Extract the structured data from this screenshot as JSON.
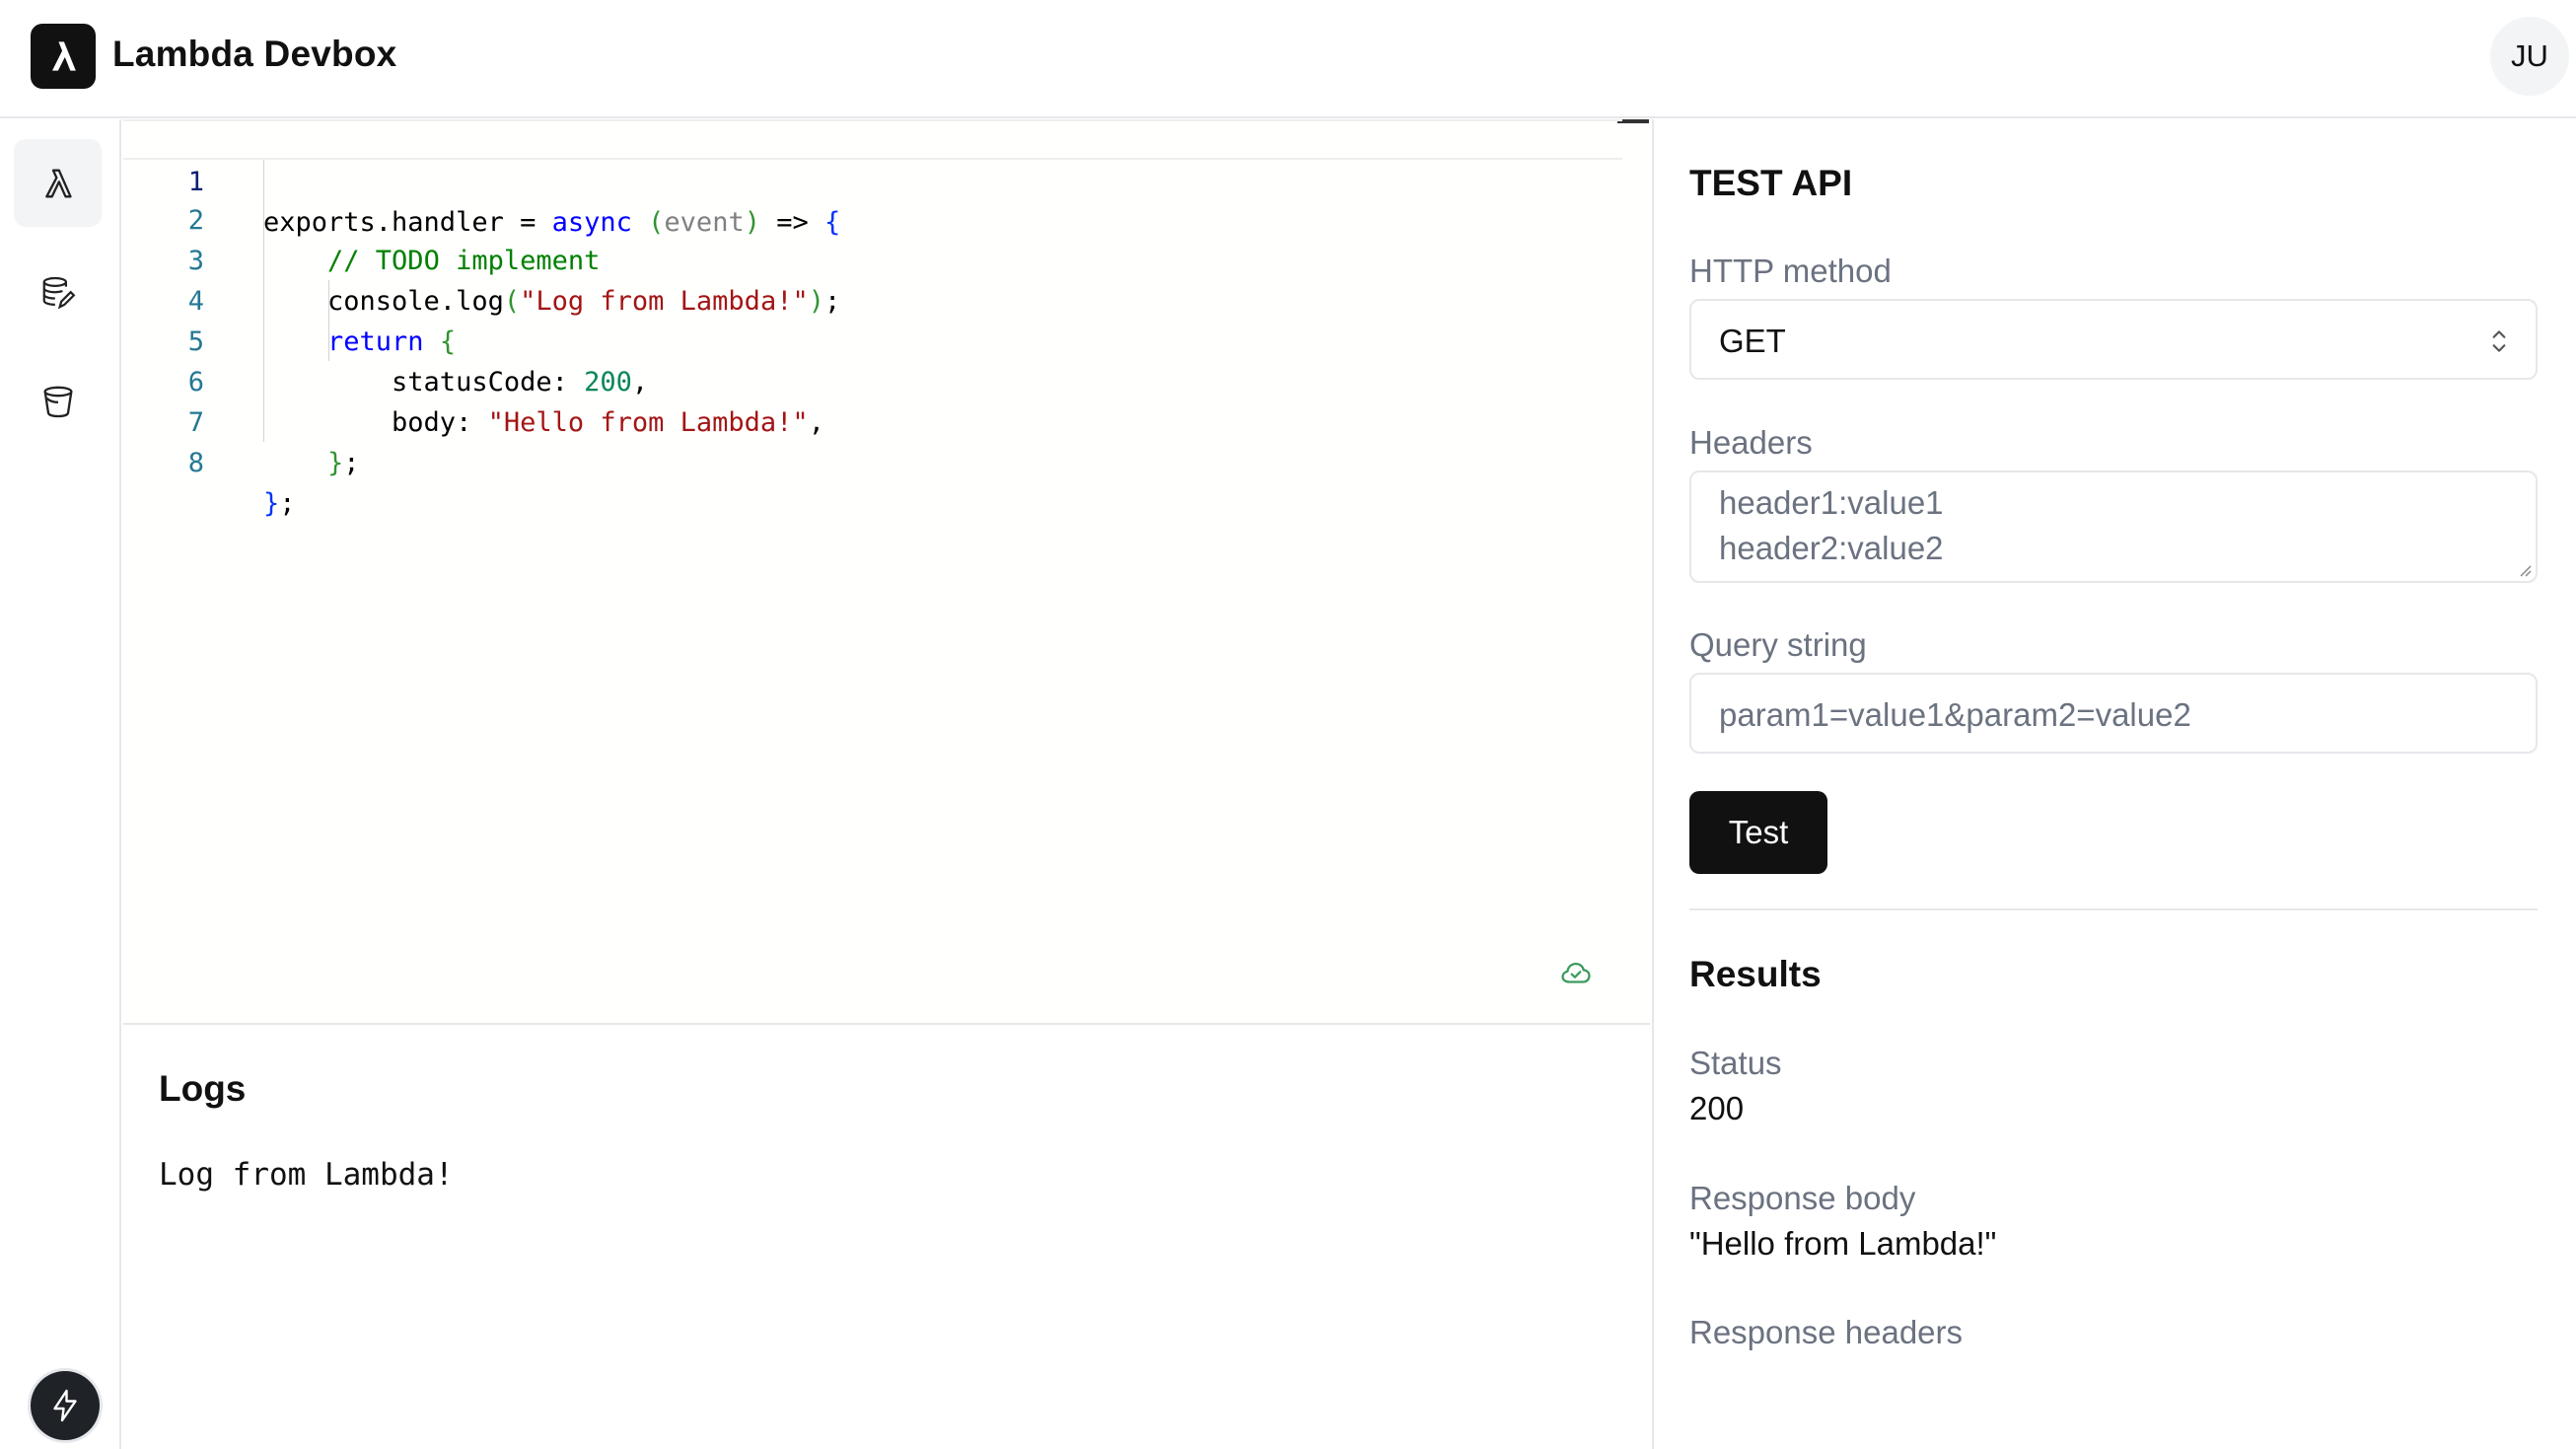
{
  "header": {
    "app_title": "Lambda Devbox",
    "avatar_initials": "JU",
    "logo_icon": "lambda-icon"
  },
  "sidebar": {
    "items": [
      {
        "name": "functions",
        "icon": "lambda-icon",
        "active": true
      },
      {
        "name": "databases",
        "icon": "database-icon",
        "active": false
      },
      {
        "name": "storage",
        "icon": "bucket-icon",
        "active": false
      }
    ],
    "footer_icon": "lightning-bolt-icon"
  },
  "editor": {
    "line_numbers": [
      "1",
      "2",
      "3",
      "4",
      "5",
      "6",
      "7",
      "8"
    ],
    "lines": [
      "exports.handler = async (event) => {",
      "    // TODO implement",
      "    console.log(\"Log from Lambda!\");",
      "    return {",
      "        statusCode: 200,",
      "        body: \"Hello from Lambda!\",",
      "    };",
      "};"
    ],
    "current_line": "1",
    "status_icon": "cloud-check-icon"
  },
  "logs": {
    "title": "Logs",
    "output": "Log from Lambda!"
  },
  "test_api": {
    "title": "TEST API",
    "http_method_label": "HTTP method",
    "http_method_value": "GET",
    "headers_label": "Headers",
    "headers_lines": [
      "header1:value1",
      "header2:value2"
    ],
    "query_label": "Query string",
    "query_placeholder": "param1=value1&param2=value2",
    "test_button": "Test"
  },
  "results": {
    "title": "Results",
    "status_label": "Status",
    "status_value": "200",
    "body_label": "Response body",
    "body_value": "\"Hello from Lambda!\"",
    "headers_label": "Response headers"
  },
  "colors": {
    "keyword": "#0000ff",
    "string": "#a31515",
    "number": "#098658",
    "comment": "#008000",
    "primary_button": "#111111",
    "status_ok": "#3b9a5e"
  }
}
